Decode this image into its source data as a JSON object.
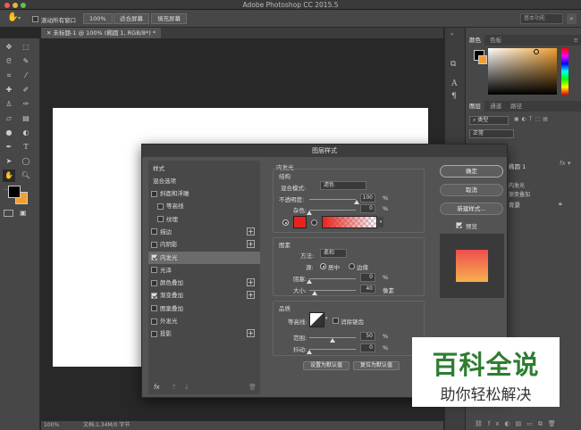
{
  "app": {
    "title": "Adobe Photoshop CC 2015.5"
  },
  "options_bar": {
    "scroll_all_windows_label": "滚动所有窗口",
    "zoom_value": "100%",
    "fit_screen_label": "适合屏幕",
    "fill_screen_label": "填充屏幕",
    "workspace_label": "基本功能"
  },
  "document": {
    "tab_label": "未标题-1 @ 100% (椭圆 1, RGB/8*) *",
    "status_zoom": "100%",
    "status_doc": "文档:1.34M/0 字节"
  },
  "right_panel": {
    "color_tabs": [
      "颜色",
      "色板"
    ],
    "layer_tabs": [
      "图层",
      "通道",
      "路径"
    ],
    "layer_filter": "类型",
    "blend_mode": "正常",
    "layer_name": "椭圆 1",
    "effects_label": "效果",
    "inner_glow_label": "内发光",
    "gradient_overlay_label": "渐变叠加",
    "bg_layer_label": "背景"
  },
  "dialog": {
    "title": "图层样式",
    "styles_header": "样式",
    "blend_options": "混合选项",
    "style_items": [
      {
        "label": "斜面和浮雕",
        "checked": false,
        "indent": false,
        "plus": false
      },
      {
        "label": "等高线",
        "checked": false,
        "indent": true,
        "plus": false
      },
      {
        "label": "纹理",
        "checked": false,
        "indent": true,
        "plus": false
      },
      {
        "label": "描边",
        "checked": false,
        "indent": false,
        "plus": true
      },
      {
        "label": "内阴影",
        "checked": false,
        "indent": false,
        "plus": true
      },
      {
        "label": "内发光",
        "checked": true,
        "indent": false,
        "plus": false,
        "selected": true
      },
      {
        "label": "光泽",
        "checked": false,
        "indent": false,
        "plus": false
      },
      {
        "label": "颜色叠加",
        "checked": false,
        "indent": false,
        "plus": true
      },
      {
        "label": "渐变叠加",
        "checked": true,
        "indent": false,
        "plus": true
      },
      {
        "label": "图案叠加",
        "checked": false,
        "indent": false,
        "plus": false
      },
      {
        "label": "外发光",
        "checked": false,
        "indent": false,
        "plus": false
      },
      {
        "label": "投影",
        "checked": false,
        "indent": false,
        "plus": true
      }
    ],
    "fx_label": "fx",
    "inner_glow": {
      "section_title": "内发光",
      "structure_title": "结构",
      "blend_mode_label": "混合模式:",
      "blend_mode_value": "滤色",
      "opacity_label": "不透明度:",
      "opacity_value": "100",
      "noise_label": "杂色:",
      "noise_value": "0",
      "percent": "%",
      "glow_color": "#e8231f",
      "elements_title": "图素",
      "method_label": "方法:",
      "method_value": "柔和",
      "source_label": "源:",
      "source_center": "居中",
      "source_edge": "边缘",
      "choke_label": "阻塞:",
      "choke_value": "0",
      "size_label": "大小:",
      "size_value": "40",
      "size_unit": "像素",
      "quality_title": "品质",
      "contour_label": "等高线:",
      "antialias_label": "消除锯齿",
      "range_label": "范围:",
      "range_value": "50",
      "jitter_label": "抖动:",
      "jitter_value": "0",
      "make_default": "设置为默认值",
      "reset_default": "复位为默认值"
    },
    "buttons": {
      "ok": "确定",
      "cancel": "取消",
      "new_style": "新建样式...",
      "preview": "预览"
    }
  },
  "watermark": {
    "line1": "百科全说",
    "line2": "助你轻松解决"
  },
  "colors": {
    "accent_orange": "#f0a030",
    "preview_gradient_top": "#ee4f4f",
    "preview_gradient_bottom": "#f7b04d"
  }
}
